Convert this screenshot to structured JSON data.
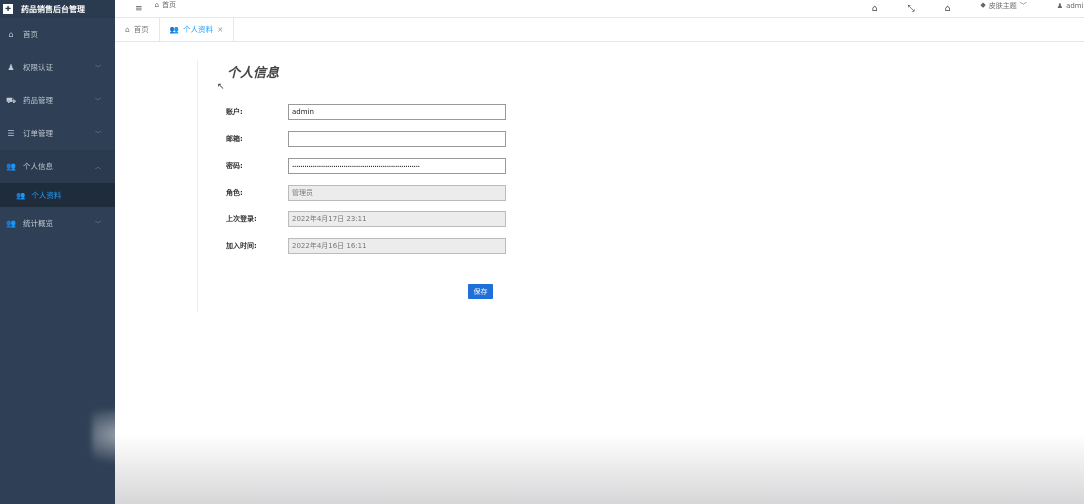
{
  "app": {
    "title": "药品销售后台管理"
  },
  "header": {
    "home_label": "首页",
    "theme_label": "皮肤主题",
    "user_label": "admin"
  },
  "sidebar": {
    "items": [
      {
        "label": "首页",
        "icon": "home-icon"
      },
      {
        "label": "权限认证",
        "icon": "user-key-icon"
      },
      {
        "label": "药品管理",
        "icon": "car-icon"
      },
      {
        "label": "订单管理",
        "icon": "list-icon"
      },
      {
        "label": "个人信息",
        "icon": "users-icon"
      },
      {
        "label": "统计概览",
        "icon": "users-icon"
      }
    ],
    "sub_item": {
      "label": "个人资料",
      "icon": "users-icon"
    }
  },
  "tabs": [
    {
      "label": "首页",
      "icon": "home-icon"
    },
    {
      "label": "个人资料",
      "icon": "users-icon",
      "close": "×"
    }
  ],
  "form": {
    "title": "个人信息",
    "fields": [
      {
        "label": "账户:",
        "value": "admin",
        "readonly": false
      },
      {
        "label": "邮箱:",
        "value": "",
        "readonly": false
      },
      {
        "label": "密码:",
        "value": "••••••••••••••••••••••••••••••••••••••••••••••••••••••••••••••",
        "readonly": false
      },
      {
        "label": "角色:",
        "value": "管理员",
        "readonly": true
      },
      {
        "label": "上次登录:",
        "value": "2022年4月17日 23:11",
        "readonly": true
      },
      {
        "label": "加入时间:",
        "value": "2022年4月16日 16:11",
        "readonly": true
      }
    ],
    "save_label": "保存"
  },
  "colors": {
    "sidebar": "#2f4056",
    "accent": "#1e9fff",
    "button": "#1e6fd9"
  }
}
